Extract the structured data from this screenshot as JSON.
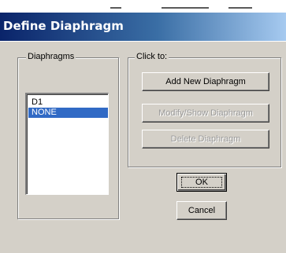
{
  "window": {
    "title": "Define Diaphragm"
  },
  "diaphragms_group": {
    "label": "Diaphragms",
    "items": [
      {
        "label": "D1",
        "selected": false
      },
      {
        "label": "NONE",
        "selected": true
      }
    ]
  },
  "click_to_group": {
    "label": "Click to:",
    "buttons": {
      "add": {
        "label": "Add New Diaphragm",
        "enabled": true
      },
      "modify": {
        "label": "Modify/Show Diaphragm",
        "enabled": false
      },
      "delete": {
        "label": "Delete Diaphragm",
        "enabled": false
      }
    }
  },
  "dialog_buttons": {
    "ok_label": "OK",
    "cancel_label": "Cancel"
  },
  "colors": {
    "face": "#d4d0c8",
    "title_start": "#0a246a",
    "title_end": "#a6caf0",
    "selection": "#316ac5"
  }
}
